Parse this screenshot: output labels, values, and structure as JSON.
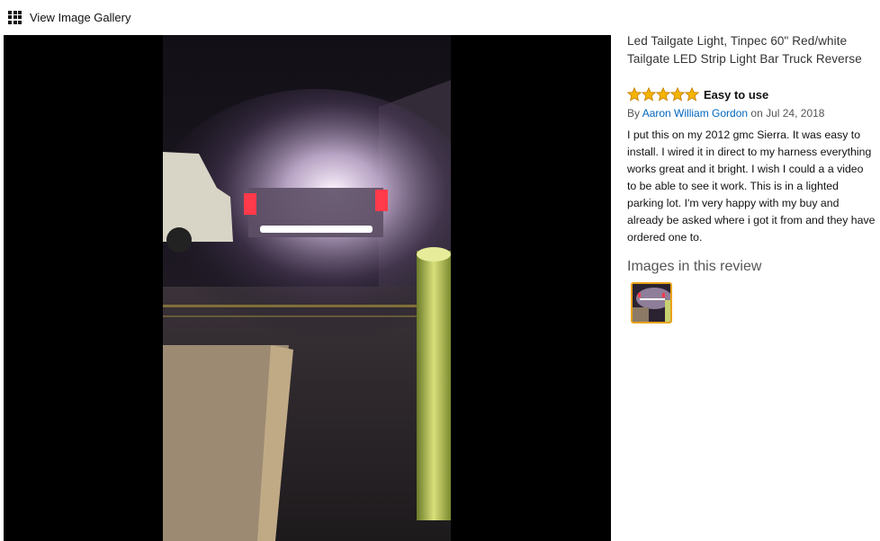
{
  "gallery": {
    "label": "View Image Gallery",
    "icon": "grid-icon"
  },
  "viewer": {
    "image_description_icon": "photo-viewer"
  },
  "review": {
    "product_title": "Led Tailgate Light, Tinpec 60\" Red/white Tailgate LED Strip Light Bar Truck Reverse",
    "rating": 5,
    "rating_max": 5,
    "title": "Easy to use",
    "by_prefix": "By ",
    "author": "Aaron William Gordon",
    "date": " on Jul 24, 2018",
    "body": "I put this on my 2012 gmc Sierra. It was easy to install. I wired it in direct to my harness everything works great and it bright. I wish I could a a video to be able to see it work. This is in a lighted parking lot. I'm very happy with my buy and already be asked where i got it from and they have ordered one to.",
    "images_heading": "Images in this review"
  },
  "colors": {
    "star": "#f4b400",
    "star_outline": "#c47b00",
    "link": "#0066c0",
    "thumb_border": "#e8a317"
  }
}
